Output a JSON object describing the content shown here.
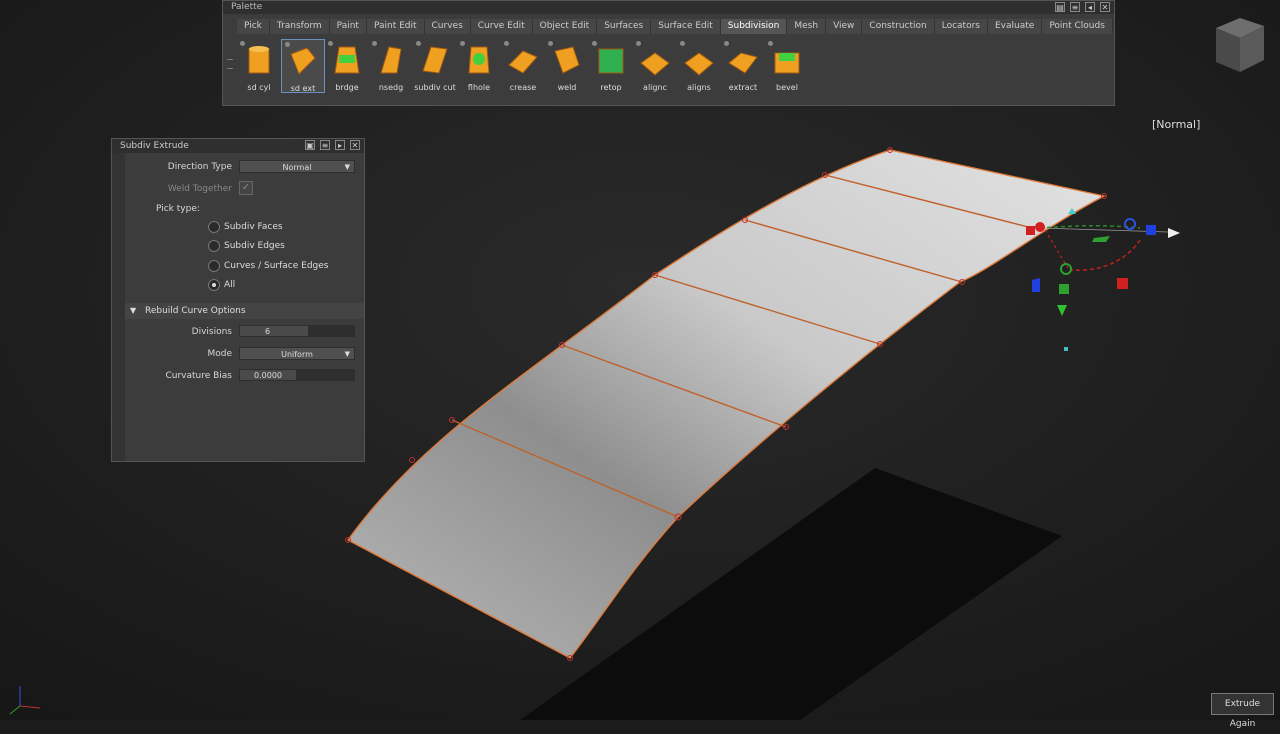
{
  "palette": {
    "title": "Palette",
    "tabs": [
      {
        "label": "Pick",
        "active": false
      },
      {
        "label": "Transform",
        "active": false
      },
      {
        "label": "Paint",
        "active": false
      },
      {
        "label": "Paint Edit",
        "active": false
      },
      {
        "label": "Curves",
        "active": false
      },
      {
        "label": "Curve Edit",
        "active": false
      },
      {
        "label": "Object Edit",
        "active": false
      },
      {
        "label": "Surfaces",
        "active": false
      },
      {
        "label": "Surface Edit",
        "active": false
      },
      {
        "label": "Subdivision",
        "active": true
      },
      {
        "label": "Mesh",
        "active": false
      },
      {
        "label": "View",
        "active": false
      },
      {
        "label": "Construction",
        "active": false
      },
      {
        "label": "Locators",
        "active": false
      },
      {
        "label": "Evaluate",
        "active": false
      },
      {
        "label": "Point Clouds",
        "active": false
      }
    ],
    "tools": [
      {
        "label": "sd cyl",
        "icon": "subdiv-cylinder-icon"
      },
      {
        "label": "sd ext",
        "icon": "subdiv-extrude-icon",
        "selected": true
      },
      {
        "label": "brdge",
        "icon": "bridge-icon"
      },
      {
        "label": "nsedg",
        "icon": "insert-edge-icon"
      },
      {
        "label": "subdiv cut",
        "icon": "subdiv-cut-icon"
      },
      {
        "label": "flhole",
        "icon": "fill-hole-icon"
      },
      {
        "label": "crease",
        "icon": "crease-icon"
      },
      {
        "label": "weld",
        "icon": "weld-icon"
      },
      {
        "label": "retop",
        "icon": "retopology-icon"
      },
      {
        "label": "alignc",
        "icon": "align-curve-icon"
      },
      {
        "label": "aligns",
        "icon": "align-surface-icon"
      },
      {
        "label": "extract",
        "icon": "extract-icon"
      },
      {
        "label": "bevel",
        "icon": "bevel-icon"
      }
    ]
  },
  "panel": {
    "title": "Subdiv Extrude",
    "direction_type_label": "Direction Type",
    "direction_type_value": "Normal",
    "weld_together_label": "Weld Together",
    "pick_type_label": "Pick type:",
    "pick_options": [
      "Subdiv Faces",
      "Subdiv Edges",
      "Curves / Surface Edges",
      "All"
    ],
    "pick_selected": "All",
    "rebuild_section_label": "Rebuild Curve Options",
    "divisions_label": "Divisions",
    "divisions_value": "6",
    "mode_label": "Mode",
    "mode_value": "Uniform",
    "curvature_bias_label": "Curvature Bias",
    "curvature_bias_value": "0.0000"
  },
  "viewport": {
    "mode_label": "[Normal]",
    "extrude_again_label": "Extrude Again"
  },
  "colors": {
    "edge": "#e07a3a",
    "surface": "#c8c8c8",
    "background": "#1c1c1c",
    "panel": "#3c3c3c"
  }
}
